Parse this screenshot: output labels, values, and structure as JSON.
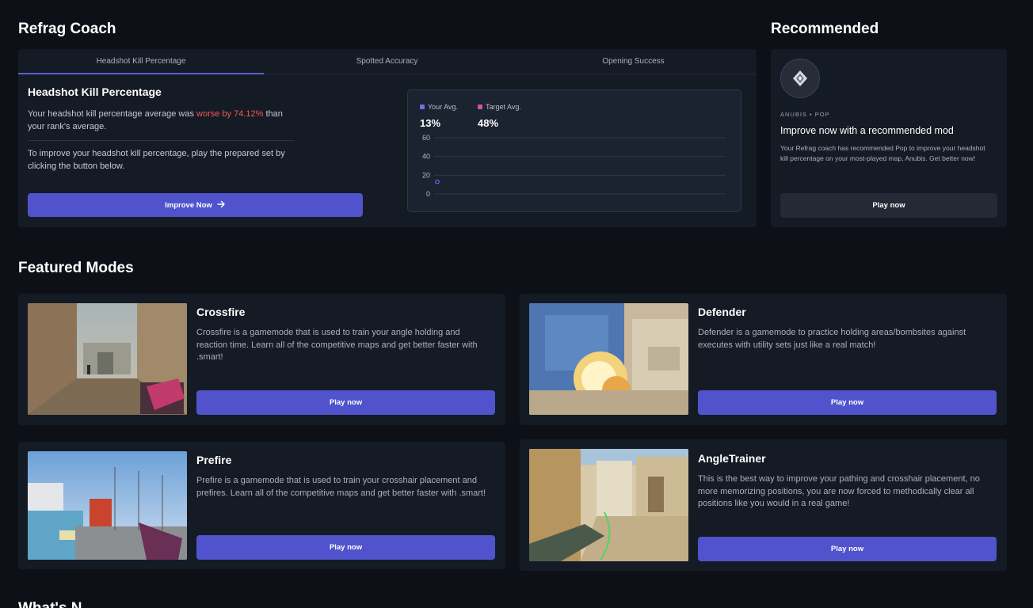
{
  "coach": {
    "title": "Refrag Coach",
    "tabs": [
      {
        "label": "Headshot Kill Percentage",
        "active": true
      },
      {
        "label": "Spotted Accuracy",
        "active": false
      },
      {
        "label": "Opening Success",
        "active": false
      }
    ],
    "heading": "Headshot Kill Percentage",
    "text_before": "Your headshot kill percentage average was ",
    "text_highlight": "worse by 74.12%",
    "text_after": " than your rank's average.",
    "text_2": "To improve your headshot kill percentage, play the prepared set by clicking the button below.",
    "button_label": "Improve Now",
    "chart": {
      "legend": [
        {
          "name": "Your Avg.",
          "value": "13%",
          "color": "#6b6ef0"
        },
        {
          "name": "Target Avg.",
          "value": "48%",
          "color": "#d14fb5"
        }
      ]
    }
  },
  "chart_data": {
    "type": "line",
    "y_ticks": [
      "60",
      "40",
      "20",
      "0"
    ],
    "ylim": [
      0,
      60
    ],
    "series": [
      {
        "name": "Your Avg.",
        "values": [
          13
        ]
      }
    ],
    "grid": true
  },
  "recommended": {
    "title": "Recommended",
    "tag_map": "ANUBIS",
    "tag_sep": "•",
    "tag_mod": "POP",
    "heading": "Improve now with a recommended mod",
    "description": "Your Refrag coach has recommended Pop to improve your headshot kill percentage on your most-played map, Anubis. Get better now!",
    "button_label": "Play now"
  },
  "featured": {
    "title": "Featured Modes",
    "partial_heading": "What's N",
    "modes": [
      {
        "name": "Crossfire",
        "description": "Crossfire is a gamemode that is used to train your angle holding and reaction time. Learn all of the competitive maps and get better faster with .smart!",
        "button": "Play now"
      },
      {
        "name": "Defender",
        "description": "Defender is a gamemode to practice holding areas/bombsites against executes with utility sets just like a real match!",
        "button": "Play now"
      },
      {
        "name": "Prefire",
        "description": "Prefire is a gamemode that is used to train your crosshair placement and prefires. Learn all of the competitive maps and get better faster with .smart!",
        "button": "Play now"
      },
      {
        "name": "AngleTrainer",
        "description": "This is the best way to improve your pathing and crosshair placement, no more memorizing positions, you are now forced to methodically clear all positions like you would in a real game!",
        "button": "Play now"
      }
    ]
  },
  "icons": {
    "improve_arrow": "arrow-right-icon",
    "rec_avatar": "map-emblem-icon"
  }
}
